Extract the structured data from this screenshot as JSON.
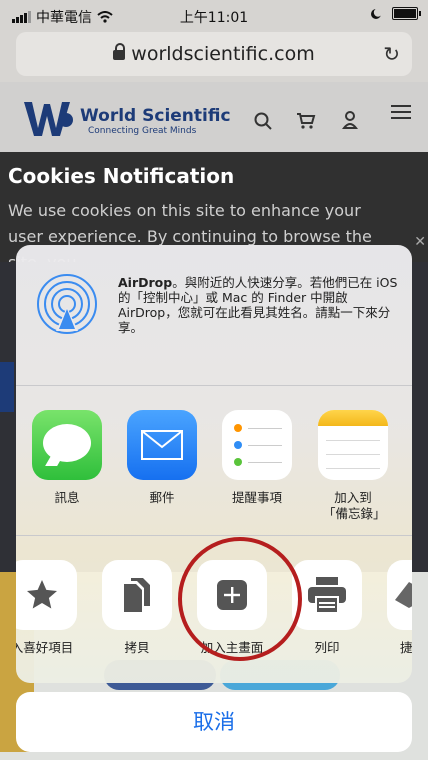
{
  "status": {
    "carrier": "中華電信",
    "time": "上午11:01"
  },
  "browser": {
    "url": "worldscientific.com"
  },
  "site": {
    "name": "World Scientific",
    "tagline": "Connecting Great Minds"
  },
  "cookie": {
    "title": "Cookies Notification",
    "body": "We use cookies on this site to enhance your user experience. By continuing to browse the site, you"
  },
  "airdrop": {
    "bold": "AirDrop",
    "text": "。與附近的人快速分享。若他們已在 iOS 的「控制中心」或 Mac 的 Finder 中開啟 AirDrop，您就可在此看見其姓名。請點一下來分享。"
  },
  "apps": [
    {
      "label": "訊息",
      "icon": "messages-icon"
    },
    {
      "label": "郵件",
      "icon": "mail-icon"
    },
    {
      "label": "提醒事項",
      "icon": "reminders-icon"
    },
    {
      "label": "加入到「備忘錄」",
      "icon": "notes-icon"
    }
  ],
  "actions": [
    {
      "label": "入喜好項目",
      "icon": "star-icon"
    },
    {
      "label": "拷貝",
      "icon": "copy-icon"
    },
    {
      "label": "加入主畫面",
      "icon": "add-to-home-icon"
    },
    {
      "label": "列印",
      "icon": "print-icon"
    },
    {
      "label": "捷",
      "icon": "shortcut-icon"
    }
  ],
  "cancel_label": "取消",
  "colors": {
    "cancel_blue": "#1a6ee8",
    "highlight_circle": "#b51e1e",
    "brand_navy": "#1d3b78"
  }
}
